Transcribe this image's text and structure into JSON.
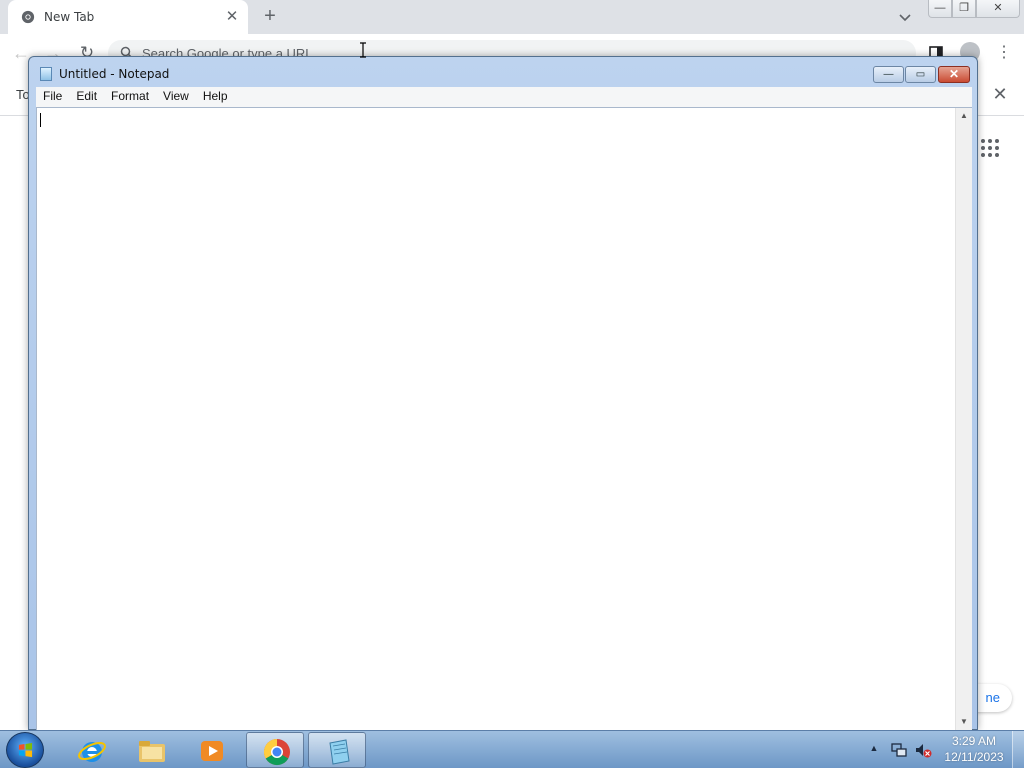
{
  "chrome": {
    "tab_title": "New Tab",
    "tab_close": "✕",
    "new_tab": "+",
    "omnibox_placeholder": "Search Google or type a URL",
    "infobar_text": "To",
    "infobar_close": "✕",
    "customize_chip": "ne",
    "icons": [
      "chrome-icon",
      "tab-search-icon",
      "back-icon",
      "forward-icon",
      "reload-icon",
      "search-icon",
      "side-panel-icon",
      "profile-icon",
      "menu-icon",
      "apps-grid-icon"
    ]
  },
  "notepad": {
    "title": "Untitled - Notepad",
    "menus": [
      "File",
      "Edit",
      "Format",
      "View",
      "Help"
    ],
    "content": "",
    "controls": {
      "minimize": "—",
      "maximize": "▭",
      "close": "✕"
    }
  },
  "taskbar": {
    "pinned": [
      "internet-explorer",
      "windows-explorer",
      "windows-media-player",
      "google-chrome",
      "notepad"
    ],
    "active": [
      "google-chrome",
      "notepad"
    ],
    "clock": {
      "time": "3:29 AM",
      "date": "12/11/2023"
    },
    "tray_icons": [
      "show-hidden-icons",
      "network-icon",
      "volume-muted-icon"
    ]
  },
  "colors": {
    "taskbar": "#7fa6d4",
    "notepad_frame": "#b3cdee",
    "close_button": "#c94b33",
    "chrome_tabstrip": "#dee1e6"
  }
}
